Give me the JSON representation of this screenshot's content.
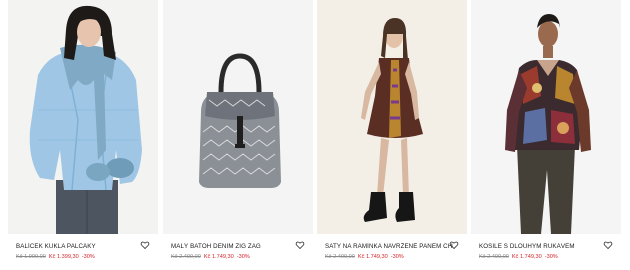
{
  "products": [
    {
      "title": "BALÍČEK KUKLA PALČÁKY",
      "old_price": "Kč 1.999,00",
      "new_price": "Kč 1.399,30",
      "discount": "-30%",
      "image": "model-in-light-blue-puffer-jacket-with-hood-scarf",
      "favorite_icon": "heart-outline-icon"
    },
    {
      "title": "MALÝ BATOH DENIM ZIG ZAG",
      "old_price": "Kč 2.499,00",
      "new_price": "Kč 1.749,30",
      "discount": "-30%",
      "image": "small-patterned-denim-backpack",
      "favorite_icon": "heart-outline-icon"
    },
    {
      "title": "ŠATY NA RAMÍNKA NAVRŽENÉ PANEM CHRISTIANEM LACROIX",
      "old_price": "Kč 2.499,00",
      "new_price": "Kč 1.749,30",
      "discount": "-30%",
      "image": "model-in-patchwork-strap-dress-and-boots",
      "favorite_icon": "heart-outline-icon"
    },
    {
      "title": "KOŠILE S DLOUHÝM RUKÁVEM",
      "old_price": "Kč 2.499,00",
      "new_price": "Kč 1.749,30",
      "discount": "-30%",
      "image": "model-in-patterned-long-sleeve-shirt",
      "favorite_icon": "heart-outline-icon"
    }
  ],
  "colors": {
    "sale_red": "#d4232a",
    "old_price_grey": "#8a8a8a",
    "text": "#1a1a1a"
  }
}
